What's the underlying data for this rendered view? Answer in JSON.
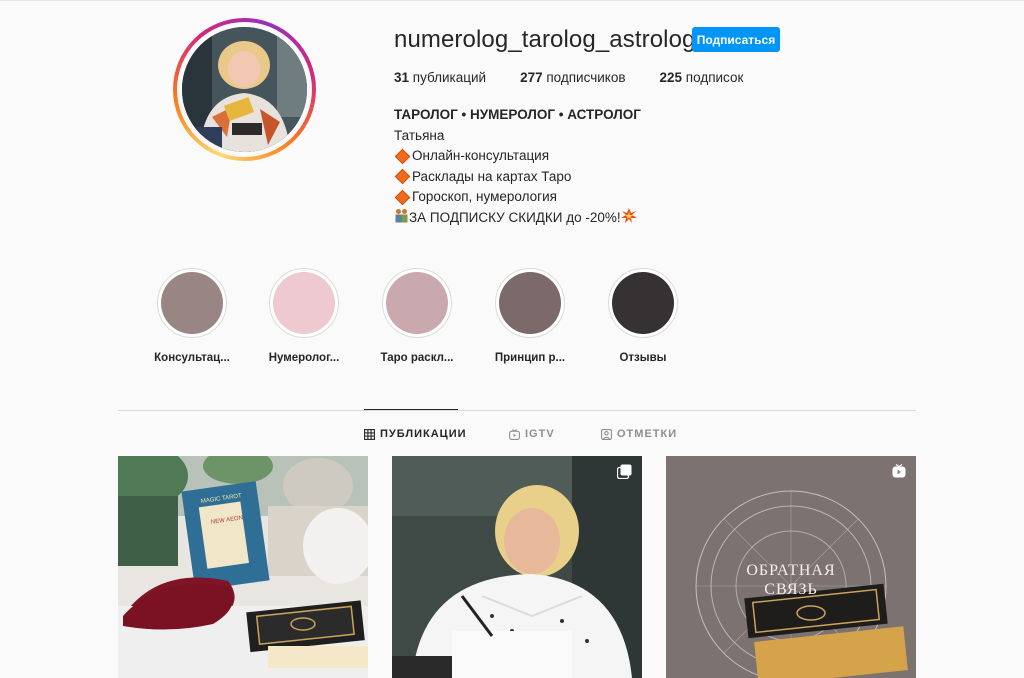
{
  "profile": {
    "username": "numerolog_tarolog_astrolog",
    "follow_label": "Подписаться",
    "stats": {
      "posts_count": "31",
      "posts_label": "публикаций",
      "followers_count": "277",
      "followers_label": "подписчиков",
      "following_count": "225",
      "following_label": "подписок"
    },
    "bio": {
      "title": "ТАРОЛОГ • НУМЕРОЛОГ • АСТРОЛОГ",
      "name": "Татьяна",
      "line1": "Онлайн-консультация",
      "line2": "Расклады на картах Таро",
      "line3": "Гороскоп, нумерология",
      "line4": "ЗА ПОДПИСКУ СКИДКИ до -20%!"
    }
  },
  "highlights": [
    {
      "label": "Консультац...",
      "color": "#9a8585"
    },
    {
      "label": "Нумеролог...",
      "color": "#eec9cf"
    },
    {
      "label": "Таро раскл...",
      "color": "#c9a9ad"
    },
    {
      "label": "Принцип р...",
      "color": "#7c6a6b"
    },
    {
      "label": "Отзывы",
      "color": "#363233"
    }
  ],
  "tabs": {
    "posts": "ПУБЛИКАЦИИ",
    "igtv": "IGTV",
    "tagged": "ОТМЕТКИ"
  },
  "posts": {
    "post3_text_line1": "ОБРАТНАЯ",
    "post3_text_line2": "СВЯЗЬ",
    "book_title_1": "MAGIC TAROT",
    "book_title_2": "NEW AEON"
  },
  "colors": {
    "accent": "#0095f6",
    "text": "#262626",
    "muted": "#8e8e8e"
  }
}
